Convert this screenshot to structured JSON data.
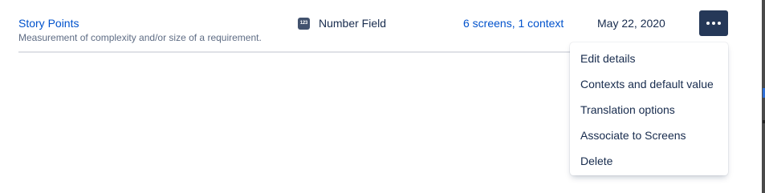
{
  "row": {
    "name": "Story Points",
    "description": "Measurement of complexity and/or size of a requirement.",
    "type_icon_text": "123",
    "type_icon": "number-field-icon",
    "type_label": "Number Field",
    "screens_link": "6 screens, 1 context",
    "last_used": "May 22, 2020",
    "more_icon": "more-horizontal-icon"
  },
  "menu": {
    "items": [
      {
        "label": "Edit details"
      },
      {
        "label": "Contexts and default value"
      },
      {
        "label": "Translation options"
      },
      {
        "label": "Associate to Screens"
      },
      {
        "label": "Delete"
      }
    ]
  },
  "colors": {
    "link": "#0052cc",
    "text": "#172b4d",
    "subtle": "#5e6c84",
    "button_bg": "#253858",
    "divider": "#dfe1e6"
  }
}
